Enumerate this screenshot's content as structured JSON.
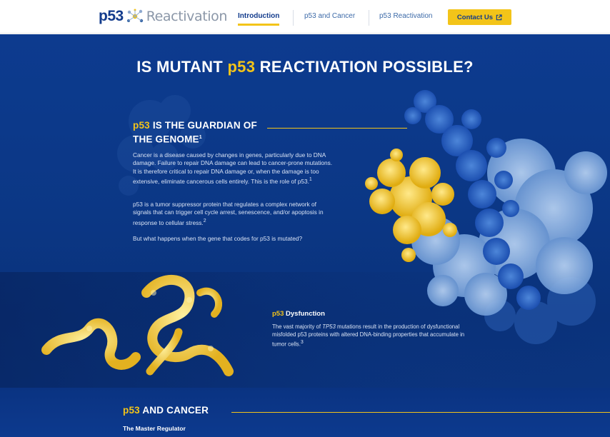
{
  "header": {
    "logo": {
      "brand": "p53",
      "word": "Reactivation"
    },
    "nav": [
      {
        "label": "Introduction",
        "active": true
      },
      {
        "label": "p53 and Cancer",
        "active": false
      },
      {
        "label": "p53 Reactivation",
        "active": false
      }
    ],
    "contact_label": "Contact Us"
  },
  "hero": {
    "headline_pre": "IS MUTANT ",
    "headline_hl": "p53",
    "headline_post": " REACTIVATION POSSIBLE?"
  },
  "guardian": {
    "title_hl": "p53",
    "title_rest_1": " IS THE GUARDIAN OF",
    "title_rest_2": "THE GENOME",
    "title_sup": "1",
    "p1": "Cancer is a disease caused by changes in genes, particularly due to DNA damage. Failure to repair DNA damage can lead to cancer-prone mutations. It is therefore critical to repair DNA damage or, when the damage is too extensive, eliminate cancerous cells entirely. This is the role of p53.",
    "p1_sup": "1",
    "p2": "p53 is a tumor suppressor protein that regulates a complex network of signals that can trigger cell cycle arrest, senescence, and/or apoptosis in response to cellular stress.",
    "p2_sup": "2",
    "p3": "But what happens when the gene that codes for p53 is mutated?"
  },
  "dysfunction": {
    "title_hl": "p53",
    "title_rest": " Dysfunction",
    "text_pre": "The vast majority of ",
    "text_italic": "TP53",
    "text_post": " mutations result in the production of dysfunctional misfolded p53 proteins with altered DNA-binding properties that accumulate in tumor cells.",
    "text_sup": "3"
  },
  "cancer": {
    "title_hl": "p53",
    "title_rest": " AND CANCER",
    "subtitle": "The Master Regulator"
  },
  "colors": {
    "brand_blue": "#123b8c",
    "accent_yellow": "#f3c419",
    "hero_bg": "#0b3785"
  }
}
